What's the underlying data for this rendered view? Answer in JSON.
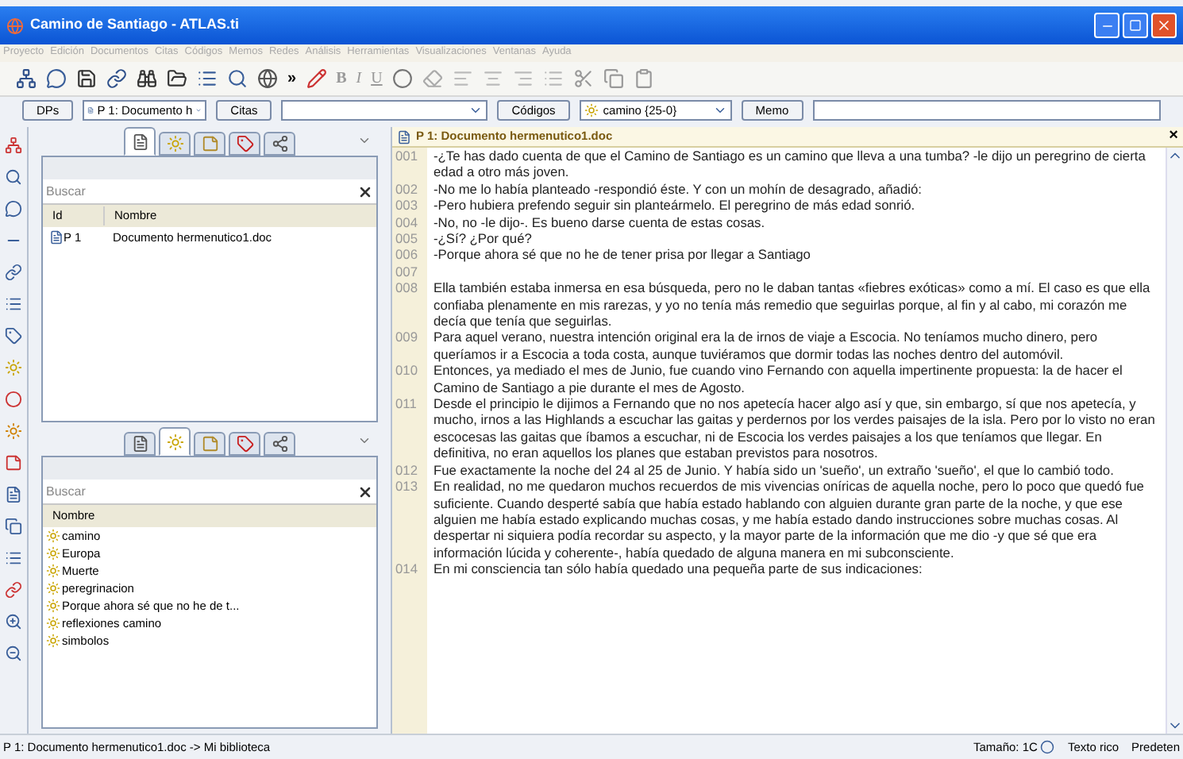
{
  "window": {
    "title": "Camino de Santiago - ATLAS.ti"
  },
  "menu": [
    "Proyecto",
    "Edición",
    "Documentos",
    "Citas",
    "Códigos",
    "Memos",
    "Redes",
    "Análisis",
    "Herramientas",
    "Visualizaciones",
    "Ventanas",
    "Ayuda"
  ],
  "toolbar": {
    "overflow": "»",
    "format": [
      "B",
      "I",
      "U"
    ]
  },
  "selector_bar": {
    "documents_button": "DPs",
    "document_combo": "P 1: Documento h",
    "quotes_button": "Citas",
    "codes_button": "Códigos",
    "code_combo": "camino {25-0}",
    "memo_button": "Memo"
  },
  "documents_pane": {
    "tabs": [
      {
        "kind": "document",
        "selected": true
      },
      {
        "kind": "code",
        "selected": false
      },
      {
        "kind": "quote",
        "selected": false
      },
      {
        "kind": "memo",
        "selected": false
      },
      {
        "kind": "network",
        "selected": false
      }
    ],
    "search": {
      "placeholder": "Buscar"
    },
    "columns": [
      "Id",
      "Nombre"
    ],
    "rows": [
      {
        "id": "P 1",
        "name": "Documento hermenutico1.doc"
      }
    ]
  },
  "codes_pane": {
    "tabs": [
      {
        "kind": "document",
        "selected": false
      },
      {
        "kind": "code",
        "selected": true
      },
      {
        "kind": "quote",
        "selected": false
      },
      {
        "kind": "memo",
        "selected": false
      },
      {
        "kind": "network",
        "selected": false
      }
    ],
    "search": {
      "placeholder": "Buscar"
    },
    "columns": [
      "Nombre"
    ],
    "items": [
      "camino",
      "Europa",
      "Muerte",
      "peregrinacion",
      "Porque ahora sé que no he de t...",
      "reflexiones camino",
      "simbolos"
    ]
  },
  "document": {
    "title": "P 1: Documento hermenutico1.doc",
    "close": "×",
    "paragraphs": [
      {
        "number": "001",
        "text": "-¿Te has dado cuenta de que el Camino de Santiago es un camino que lleva a una tumba? -le dijo un peregrino de cierta edad a otro más joven."
      },
      {
        "number": "002",
        "text": "-No me lo había planteado -respondió éste. Y con un mohín de desagrado, añadió:"
      },
      {
        "number": "003",
        "text": "-Pero hubiera prefendo seguir sin planteármelo. El peregrino de más edad sonrió."
      },
      {
        "number": "004",
        "text": "-No, no -le dijo-. Es bueno darse cuenta de estas cosas."
      },
      {
        "number": "005",
        "text": "-¿Sí? ¿Por qué?"
      },
      {
        "number": "006",
        "text": "-Porque ahora sé que no he de tener prisa por llegar a Santiago"
      },
      {
        "number": "007"
      },
      {
        "number": "008",
        "text": "Ella también estaba inmersa en esa búsqueda, pero no le daban tantas «fiebres exóticas» como a mí. El caso es que ella confiaba plenamente en mis rarezas, y yo no tenía más remedio que seguirlas porque, al fin y al cabo, mi corazón me decía que tenía que seguirlas."
      },
      {
        "number": "009",
        "text": "Para aquel verano, nuestra intención original era la de irnos de viaje a Escocia. No teníamos mucho dinero, pero queríamos ir a Escocia a toda costa, aunque tuviéramos que dormir todas las noches dentro del automóvil."
      },
      {
        "number": "010",
        "text": "Entonces, ya mediado el mes de Junio, fue cuando vino Fernando con aquella impertinente propuesta: la de hacer el Camino de Santiago a pie durante el mes de Agosto."
      },
      {
        "number": "011",
        "text": "Desde el principio le dijimos a Fernando que no nos apetecía hacer algo así y que, sin embargo, sí que nos apetecía, y mucho, irnos a las Highlands a escuchar las gaitas y perdernos por los verdes paisajes de la isla. Pero por lo visto no eran escocesas las gaitas que íbamos a escuchar, ni de Escocia los verdes paisajes a los que teníamos que llegar. En definitiva, no eran aquellos los planes que estaban previstos para nosotros."
      },
      {
        "number": "012",
        "text": "Fue exactamente la noche del 24 al 25 de Junio. Y había sido un 'sueño', un extraño 'sueño', el que lo cambió todo."
      },
      {
        "number": "013",
        "text": "En realidad, no me quedaron muchos recuerdos de mis vivencias oníricas de aquella noche, pero lo poco que quedó fue suficiente.   Cuando  desperté sabía que había  estado hablando con alguien durante gran parte de la noche, y que ese alguien me había estado explicando muchas cosas, y me había estado dando instrucciones sobre muchas cosas. Al despertar ni siquiera podía recordar su aspecto, y la mayor parte de la información que me dio -y que sé que era información lúcida y coherente-, había quedado de alguna manera en mi subconsciente."
      },
      {
        "number": "014",
        "text": "En mi consciencia tan sólo había quedado una pequeña parte de sus indicaciones:"
      }
    ]
  },
  "status_bar": {
    "path": "P 1: Documento hermenutico1.doc -> Mi biblioteca",
    "size": "Tamaño: 1C",
    "format": "Texto rico",
    "other": "Predeten"
  }
}
